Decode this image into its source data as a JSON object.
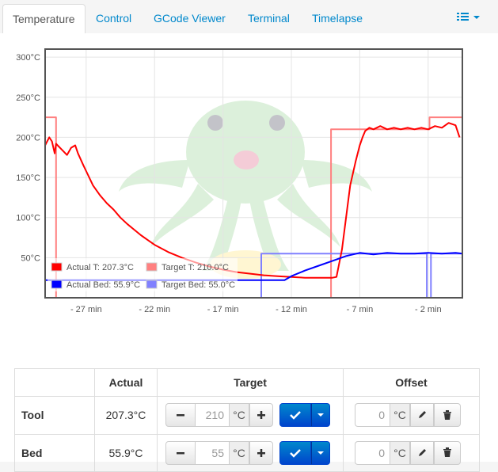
{
  "tabs": [
    {
      "label": "Temperature",
      "active": true
    },
    {
      "label": "Control"
    },
    {
      "label": "GCode Viewer"
    },
    {
      "label": "Terminal"
    },
    {
      "label": "Timelapse"
    }
  ],
  "menu_icon": "list-icon",
  "colors": {
    "actual_tool": "#ff0000",
    "target_tool": "#ff8080",
    "actual_bed": "#0000ff",
    "target_bed": "#8080ff",
    "link": "#0088cc",
    "primary": "#0055cc"
  },
  "chart_data": {
    "type": "line",
    "ylim": [
      0,
      310
    ],
    "yticks": [
      "50°C",
      "100°C",
      "150°C",
      "200°C",
      "250°C",
      "300°C"
    ],
    "ytick_values": [
      50,
      100,
      150,
      200,
      250,
      300
    ],
    "xlim": [
      -30,
      0.5
    ],
    "xticks": [
      "- 27 min",
      "- 22 min",
      "- 17 min",
      "- 12 min",
      "- 7 min",
      "- 2 min"
    ],
    "xtick_values": [
      -27,
      -22,
      -17,
      -12,
      -7,
      -2
    ],
    "grid": true,
    "legend_position": "bottom-left",
    "series": [
      {
        "name": "Actual T: 207.3°C",
        "x": [
          -30,
          -29.7,
          -29.5,
          -29.3,
          -29.2,
          -28.8,
          -28.4,
          -28.1,
          -27.8,
          -27.6,
          -27.2,
          -27,
          -26.5,
          -26,
          -25.5,
          -25,
          -24.5,
          -24,
          -23.5,
          -23,
          -22.5,
          -22,
          -21,
          -20,
          -19,
          -18,
          -17,
          -16,
          -15,
          -14,
          -13,
          -12,
          -11,
          -10,
          -9.5,
          -9,
          -8.7,
          -8.3,
          -8,
          -7.7,
          -7.3,
          -7,
          -6.8,
          -6.6,
          -6.3,
          -6,
          -5.5,
          -5,
          -4.5,
          -4,
          -3.5,
          -3,
          -2.5,
          -2,
          -1.5,
          -1,
          -0.5,
          0,
          0.3
        ],
        "y": [
          190,
          200,
          195,
          180,
          192,
          185,
          178,
          187,
          190,
          180,
          165,
          158,
          140,
          128,
          118,
          110,
          100,
          92,
          85,
          78,
          72,
          66,
          57,
          50,
          44,
          39,
          35,
          32,
          30,
          28,
          27,
          26,
          25,
          25,
          25,
          25,
          26,
          60,
          100,
          140,
          170,
          190,
          200,
          208,
          212,
          210,
          214,
          210,
          212,
          210,
          212,
          210,
          212,
          210,
          214,
          212,
          218,
          215,
          200
        ],
        "color": "#ff0000"
      },
      {
        "name": "Target T: 210.0°C",
        "x": [
          -30,
          -29.2,
          -29.2,
          -28.9,
          -28.9,
          -9.1,
          -9.1,
          -3.9,
          -3.9,
          -1.9,
          -1.9,
          0.5
        ],
        "y": [
          225,
          225,
          0,
          0,
          0,
          0,
          210,
          210,
          210,
          210,
          225,
          225
        ],
        "color": "#ff8080"
      },
      {
        "name": "Actual Bed: 55.9°C",
        "x": [
          -30,
          -26,
          -22,
          -18,
          -14,
          -12.5,
          -12,
          -11,
          -10,
          -9,
          -8,
          -7,
          -6,
          -5,
          -4,
          -3,
          -2,
          -1,
          0,
          0.5
        ],
        "y": [
          22,
          22,
          22,
          22,
          22,
          22,
          27,
          34,
          40,
          46,
          52,
          56,
          54,
          56,
          55,
          55,
          56,
          55,
          56,
          55
        ],
        "color": "#0000ff"
      },
      {
        "name": "Target Bed: 55.0°C",
        "x": [
          -30,
          -14.2,
          -14.2,
          -2.1,
          -2.1,
          -1.8,
          -1.8,
          0.5
        ],
        "y": [
          0,
          0,
          55,
          55,
          0,
          0,
          55,
          55
        ],
        "color": "#8080ff"
      }
    ]
  },
  "table": {
    "headers": [
      "",
      "Actual",
      "Target",
      "Offset"
    ],
    "rows": [
      {
        "label": "Tool",
        "actual": "207.3°C",
        "target": "210",
        "unit": "°C",
        "offset": "0",
        "offset_unit": "°C"
      },
      {
        "label": "Bed",
        "actual": "55.9°C",
        "target": "55",
        "unit": "°C",
        "offset": "0",
        "offset_unit": "°C"
      }
    ],
    "icons": {
      "minus": "minus-icon",
      "plus": "plus-icon",
      "check": "check-icon",
      "caret": "caret-down-icon",
      "edit": "pencil-icon",
      "delete": "trash-icon"
    }
  }
}
